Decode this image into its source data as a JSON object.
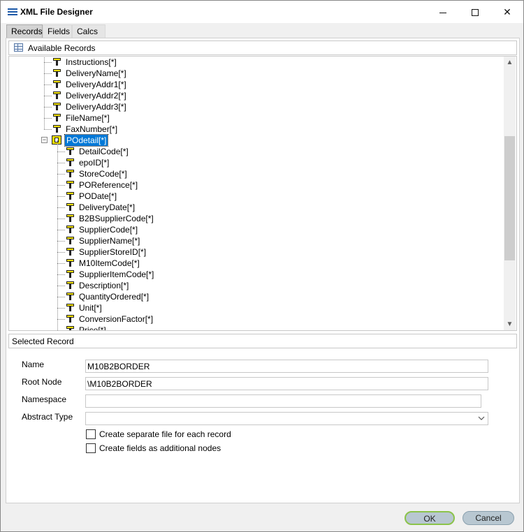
{
  "window": {
    "title": "XML File Designer"
  },
  "tabs": [
    {
      "label": "Records",
      "active": true
    },
    {
      "label": "Fields",
      "active": false
    },
    {
      "label": "Calcs",
      "active": false
    }
  ],
  "available_records": {
    "header": "Available Records",
    "parent_fields": [
      "Instructions[*]",
      "DeliveryName[*]",
      "DeliveryAddr1[*]",
      "DeliveryAddr2[*]",
      "DeliveryAddr3[*]",
      "FileName[*]",
      "FaxNumber[*]"
    ],
    "selected_record": "POdetail[*]",
    "child_fields": [
      "DetailCode[*]",
      "epoID[*]",
      "StoreCode[*]",
      "POReference[*]",
      "PODate[*]",
      "DeliveryDate[*]",
      "B2BSupplierCode[*]",
      "SupplierCode[*]",
      "SupplierName[*]",
      "SupplierStoreID[*]",
      "M10ItemCode[*]",
      "SupplierItemCode[*]",
      "Description[*]",
      "QuantityOrdered[*]",
      "Unit[*]",
      "ConversionFactor[*]",
      "Price[*]"
    ]
  },
  "selected_record": {
    "header": "Selected Record",
    "name_label": "Name",
    "name_value": "M10B2BORDER",
    "root_label": "Root Node",
    "root_value": "\\M10B2BORDER",
    "namespace_label": "Namespace",
    "namespace_value": "",
    "abstract_label": "Abstract Type",
    "abstract_value": "",
    "separate_file_label": "Create separate file for each record",
    "separate_file_checked": false,
    "additional_nodes_label": "Create fields as additional nodes",
    "additional_nodes_checked": false
  },
  "buttons": {
    "ok": "OK",
    "cancel": "Cancel"
  },
  "colors": {
    "selection": "#0078d7",
    "ok_border": "#8bc34a",
    "field_icon": "#f5e400"
  }
}
